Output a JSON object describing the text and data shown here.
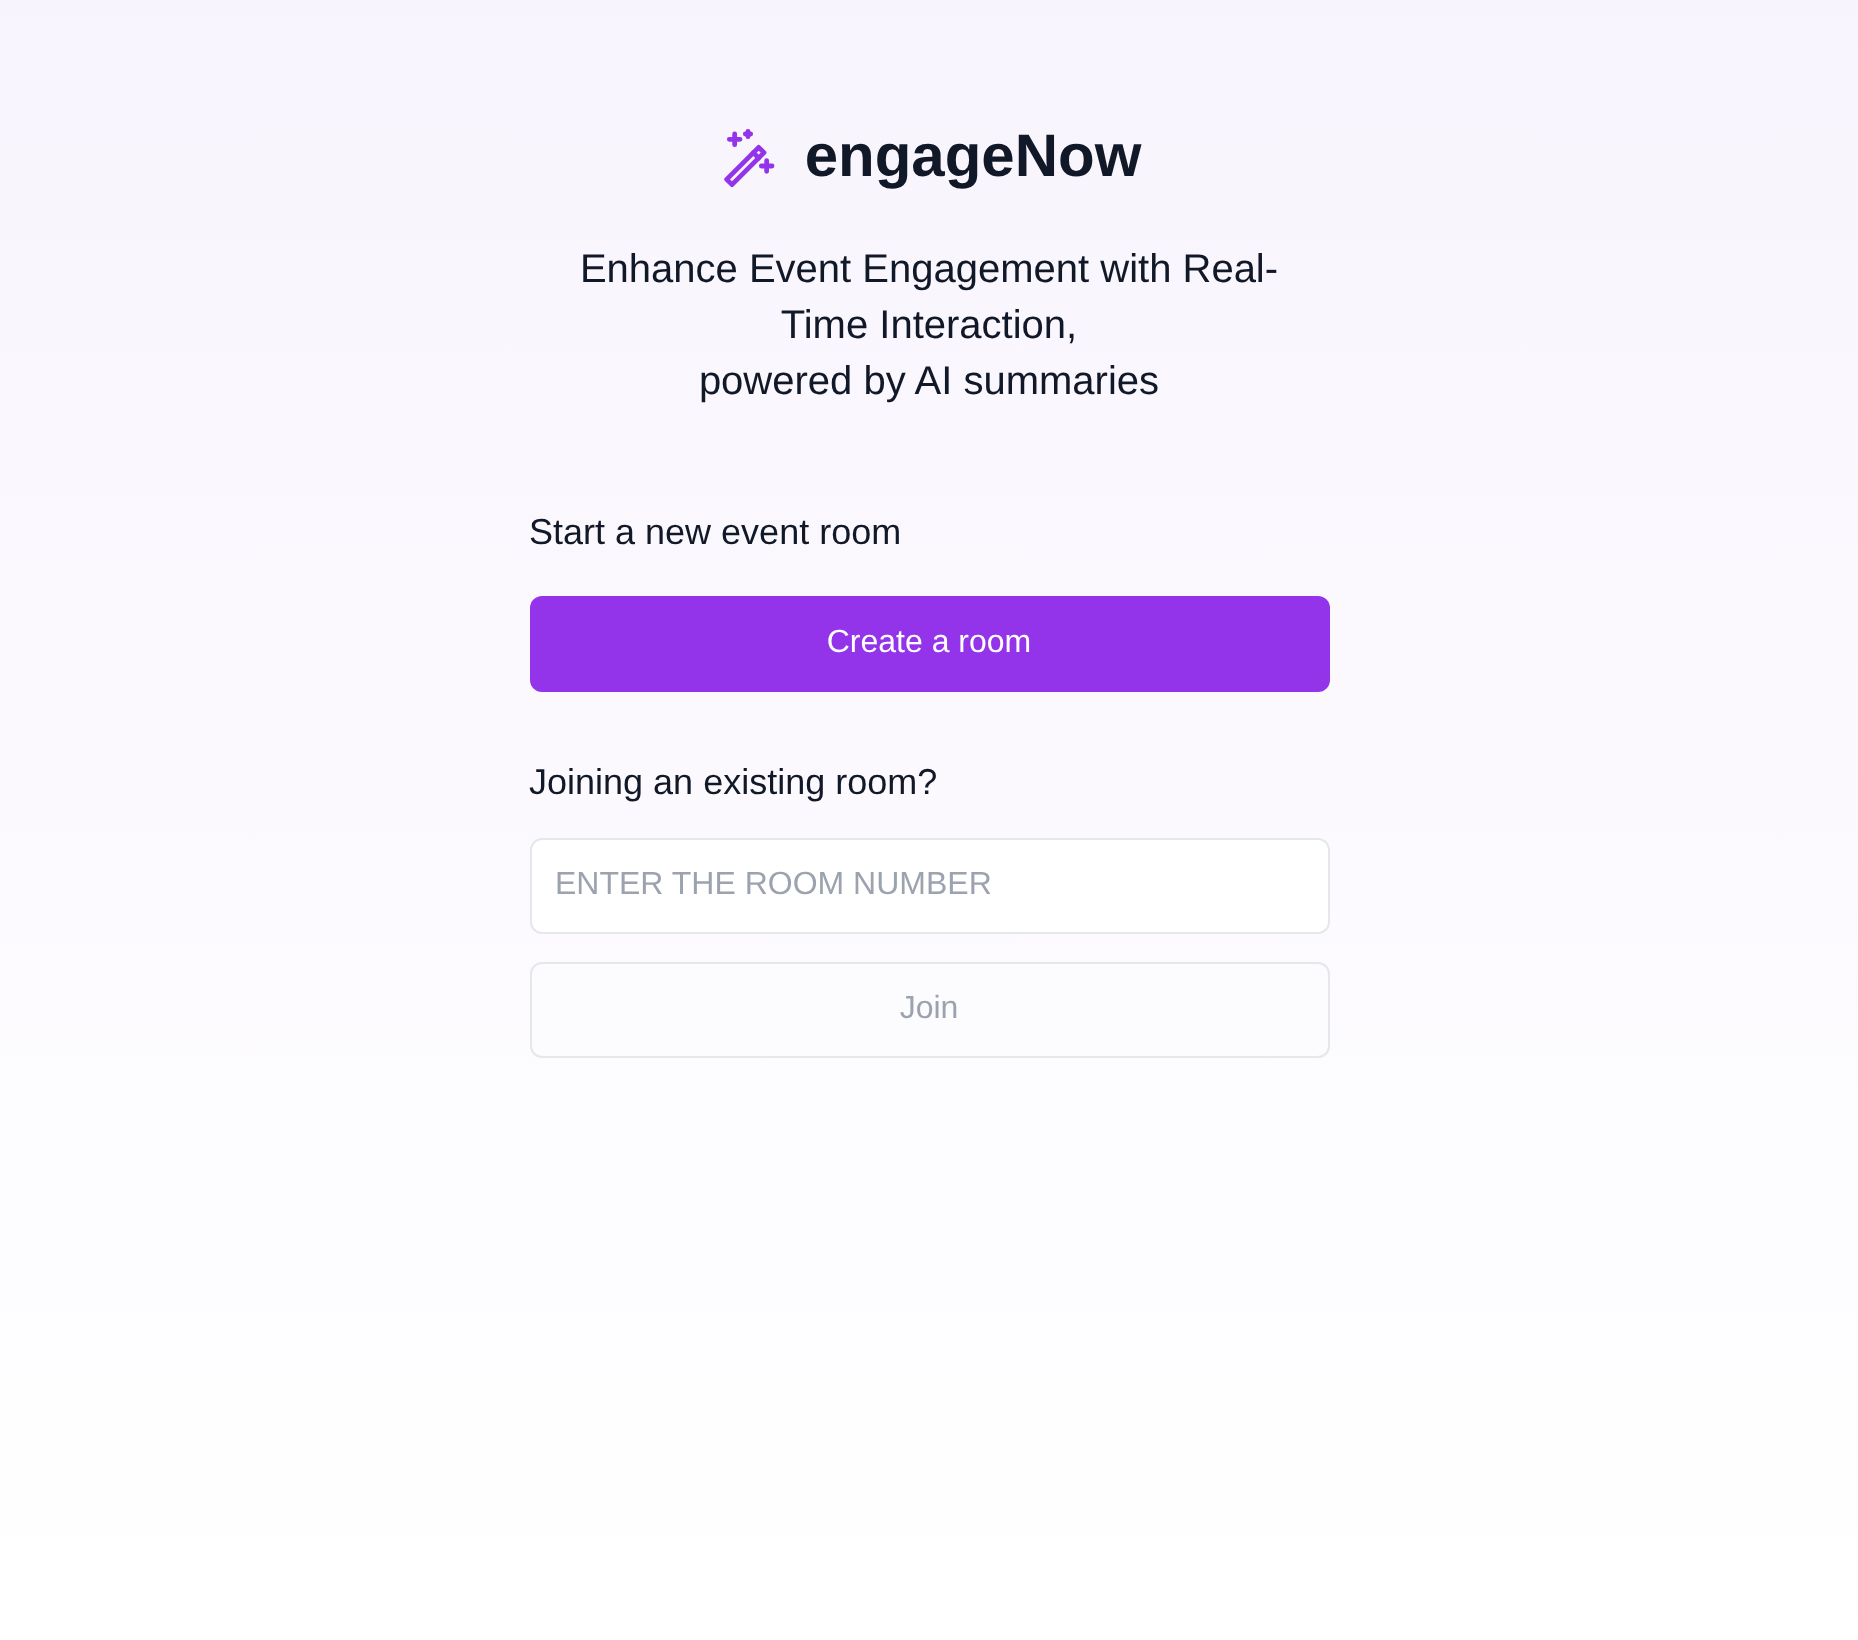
{
  "brand": {
    "name": "engageNow"
  },
  "tagline": [
    "Enhance Event Engagement with Real-Time Interaction,",
    "powered by AI summaries"
  ],
  "create": {
    "label": "Start a new event room",
    "button": "Create a room"
  },
  "join": {
    "label": "Joining an existing room?",
    "placeholder": "ENTER THE ROOM NUMBER",
    "button": "Join",
    "disabled": true
  }
}
